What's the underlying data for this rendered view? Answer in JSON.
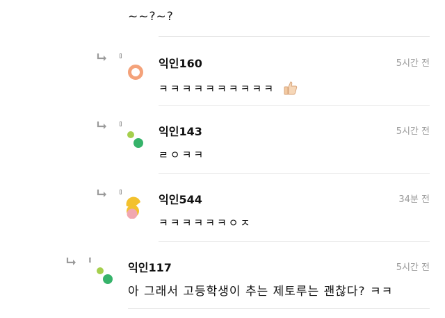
{
  "post": {
    "text": "~~?~?"
  },
  "comments": [
    {
      "nick": "익인160",
      "time": "5시간 전",
      "text": "ㅋㅋㅋㅋㅋㅋㅋㅋㅋㅋ",
      "avatar": "orange-ring-avatar",
      "extra_icon": "thumbs-up-icon",
      "accent": "#f4a27a"
    },
    {
      "nick": "익인143",
      "time": "5시간 전",
      "text": "ㄹㅇㅋㅋ",
      "avatar": "green-dots-avatar",
      "accent": "#36b36a"
    },
    {
      "nick": "익인544",
      "time": "34분 전",
      "text": "ㅋㅋㅋㅋㅋㅋㅇㅈ",
      "avatar": "yellow-pink-avatar",
      "accent": "#f3c12e"
    },
    {
      "nick": "익인117",
      "time": "5시간 전",
      "text": "아 그래서 고등학생이 추는 제토루는 괜찮다? ㅋㅋ",
      "avatar": "green-dots-avatar",
      "accent": "#36b36a"
    }
  ]
}
